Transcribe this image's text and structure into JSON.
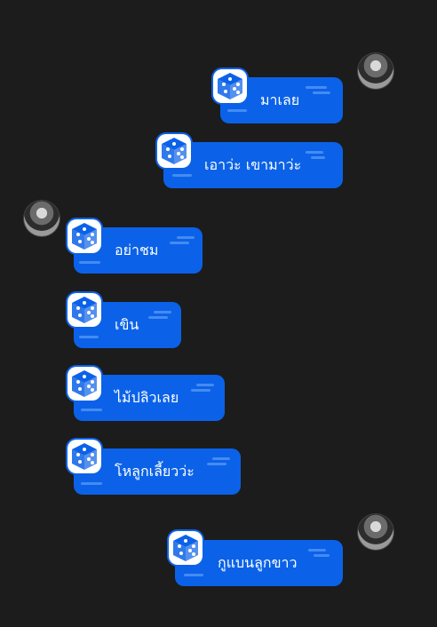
{
  "messages": [
    {
      "side": "right",
      "text": "มาเลย"
    },
    {
      "side": "right",
      "text": "เอาว่ะ เขามาว่ะ"
    },
    {
      "side": "left",
      "text": "อย่าชม"
    },
    {
      "side": "left",
      "text": "เขิน"
    },
    {
      "side": "left",
      "text": "ไม้ปลิวเลย"
    },
    {
      "side": "left",
      "text": "โหลูกเลี้ยวว่ะ"
    },
    {
      "side": "right",
      "text": "กูแบนลูกขาว"
    }
  ],
  "colors": {
    "background": "#1c1c1c",
    "bubble": "#0b62e8",
    "text": "#ffffff"
  },
  "icons": {
    "badge": "dice-cube-icon",
    "avatar": "avatar"
  }
}
